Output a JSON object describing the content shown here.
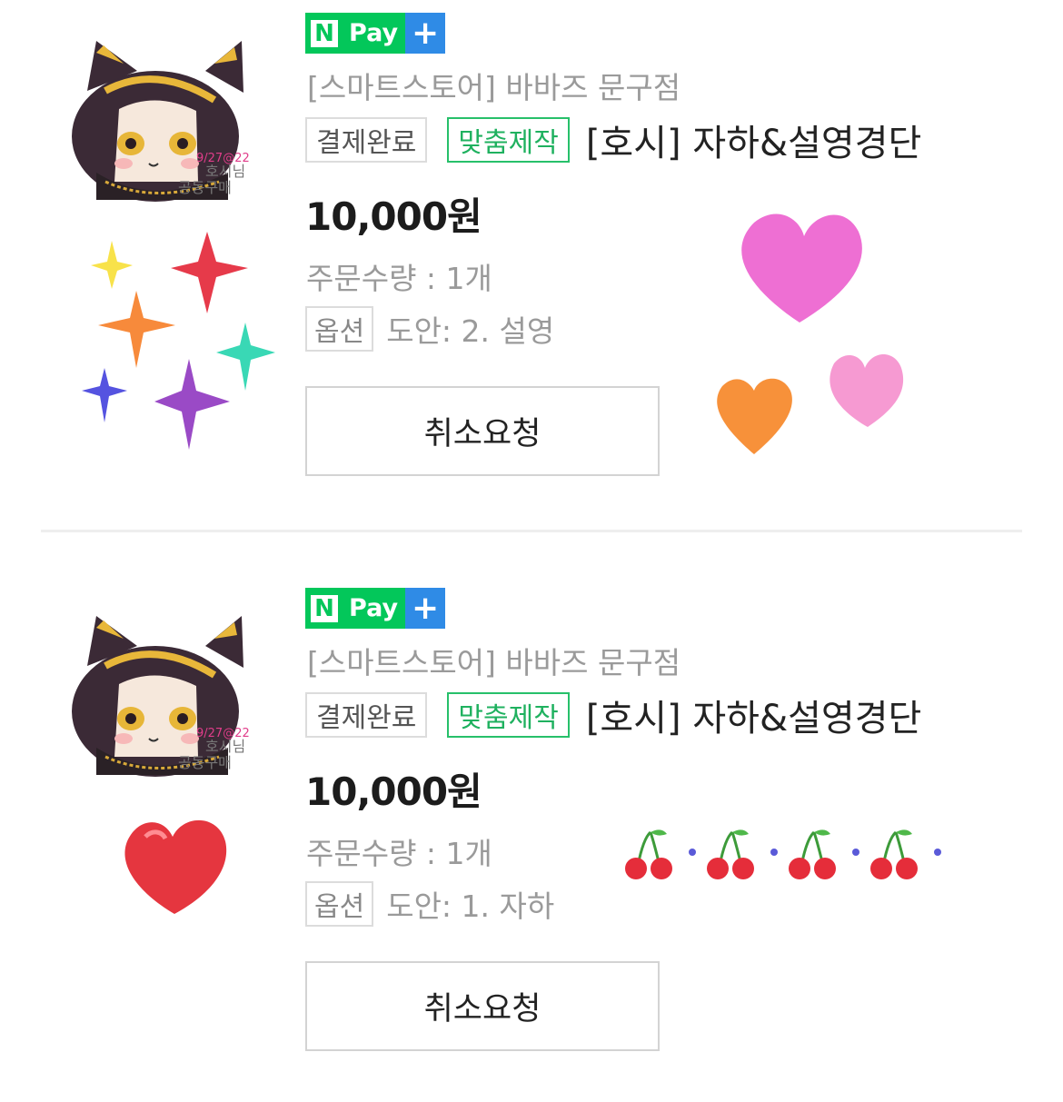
{
  "orders": [
    {
      "npay": {
        "n": "N",
        "pay": "Pay",
        "plus": "+"
      },
      "store": "[스마트스토어] 바바즈 문구점",
      "status_tag": "결제완료",
      "custom_tag": "맞춤제작",
      "product_title": "[호시] 자하&설영경단",
      "price": "10,000원",
      "quantity": "주문수량 : 1개",
      "option_label": "옵션",
      "option_value": "도안: 2. 설영",
      "cancel_label": "취소요청",
      "thumbnail_text": [
        "9/27@22",
        "호시님",
        "공동구매"
      ]
    },
    {
      "npay": {
        "n": "N",
        "pay": "Pay",
        "plus": "+"
      },
      "store": "[스마트스토어] 바바즈 문구점",
      "status_tag": "결제완료",
      "custom_tag": "맞춤제작",
      "product_title": "[호시] 자하&설영경단",
      "price": "10,000원",
      "quantity": "주문수량 : 1개",
      "option_label": "옵션",
      "option_value": "도안: 1. 자하",
      "cancel_label": "취소요청",
      "thumbnail_text": [
        "9/27@22",
        "호시님",
        "공동구매"
      ]
    }
  ],
  "colors": {
    "npay_green": "#03c75a",
    "npay_blue": "#2f8be6",
    "custom_green": "#1fb15f",
    "muted_text": "#9a9a9a"
  }
}
